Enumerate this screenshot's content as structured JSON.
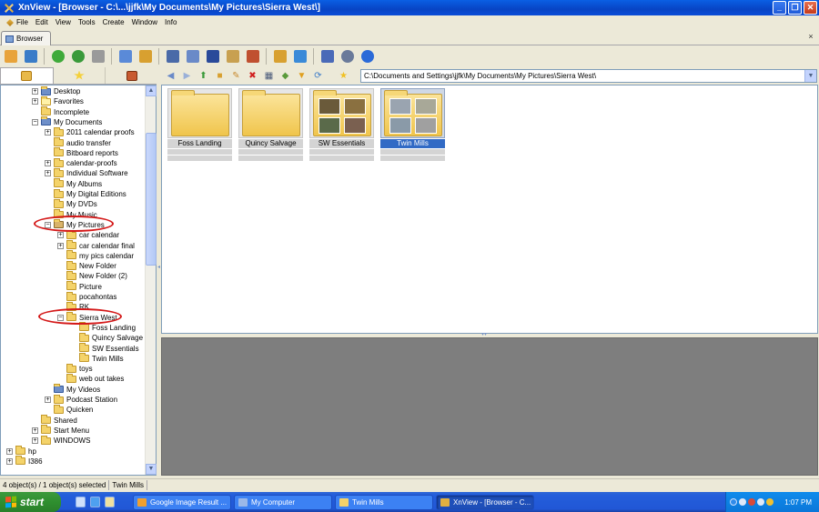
{
  "window": {
    "title": "XnView - [Browser - C:\\...\\jjfk\\My Documents\\My Pictures\\Sierra West\\]",
    "minimize": "_",
    "restore": "❐",
    "close": "✕"
  },
  "menu": [
    "File",
    "Edit",
    "View",
    "Tools",
    "Create",
    "Window",
    "Info"
  ],
  "tab": {
    "label": "Browser",
    "close": "×"
  },
  "path": "C:\\Documents and Settings\\jjfk\\My Documents\\My Pictures\\Sierra West\\",
  "tree": [
    {
      "label": "Desktop",
      "exp": "+",
      "icon": "special"
    },
    {
      "label": "Favorites",
      "exp": "+",
      "icon": "star"
    },
    {
      "label": "Incomplete",
      "exp": "",
      "icon": "folder"
    },
    {
      "label": "My Documents",
      "exp": "−",
      "icon": "special"
    },
    {
      "label": "2011 calendar proofs",
      "exp": "+",
      "icon": "folder"
    },
    {
      "label": "audio transfer",
      "exp": "",
      "icon": "folder"
    },
    {
      "label": "Bitboard reports",
      "exp": "",
      "icon": "folder"
    },
    {
      "label": "calendar-proofs",
      "exp": "+",
      "icon": "folder"
    },
    {
      "label": "Individual Software",
      "exp": "+",
      "icon": "folder"
    },
    {
      "label": "My Albums",
      "exp": "",
      "icon": "folder"
    },
    {
      "label": "My Digital Editions",
      "exp": "",
      "icon": "folder"
    },
    {
      "label": "My DVDs",
      "exp": "",
      "icon": "folder"
    },
    {
      "label": "My Music",
      "exp": "",
      "icon": "folder"
    },
    {
      "label": "My Pictures",
      "exp": "−",
      "icon": "pics"
    },
    {
      "label": "car calendar",
      "exp": "+",
      "icon": "folder"
    },
    {
      "label": "car calendar final",
      "exp": "+",
      "icon": "folder"
    },
    {
      "label": "my pics calendar",
      "exp": "",
      "icon": "folder"
    },
    {
      "label": "New Folder",
      "exp": "",
      "icon": "folder"
    },
    {
      "label": "New Folder (2)",
      "exp": "",
      "icon": "folder"
    },
    {
      "label": "Picture",
      "exp": "",
      "icon": "folder"
    },
    {
      "label": "pocahontas",
      "exp": "",
      "icon": "folder"
    },
    {
      "label": "RK",
      "exp": "",
      "icon": "folder"
    },
    {
      "label": "Sierra West",
      "exp": "−",
      "icon": "folder"
    },
    {
      "label": "Foss Landing",
      "exp": "",
      "icon": "folder"
    },
    {
      "label": "Quincy Salvage",
      "exp": "",
      "icon": "folder"
    },
    {
      "label": "SW Essentials",
      "exp": "",
      "icon": "folder"
    },
    {
      "label": "Twin Mills",
      "exp": "",
      "icon": "folder"
    },
    {
      "label": "toys",
      "exp": "",
      "icon": "folder"
    },
    {
      "label": "web out takes",
      "exp": "",
      "icon": "folder"
    },
    {
      "label": "My Videos",
      "exp": "",
      "icon": "special"
    },
    {
      "label": "Podcast Station",
      "exp": "+",
      "icon": "folder"
    },
    {
      "label": "Quicken",
      "exp": "",
      "icon": "folder"
    },
    {
      "label": "Shared",
      "exp": "",
      "icon": "folder"
    },
    {
      "label": "Start Menu",
      "exp": "+",
      "icon": "folder"
    },
    {
      "label": "WINDOWS",
      "exp": "+",
      "icon": "folder"
    },
    {
      "label": "hp",
      "exp": "+",
      "icon": "folder"
    },
    {
      "label": "I386",
      "exp": "+",
      "icon": "folder"
    }
  ],
  "thumbnails": [
    {
      "label": "Foss Landing",
      "photos": false,
      "selected": false
    },
    {
      "label": "Quincy Salvage",
      "photos": false,
      "selected": false
    },
    {
      "label": "SW Essentials",
      "photos": true,
      "selected": false
    },
    {
      "label": "Twin Mills",
      "photos": true,
      "selected": true
    }
  ],
  "status": {
    "objects": "4 object(s) / 1 object(s) selected",
    "selected_name": "Twin Mills"
  },
  "taskbar": {
    "start": "start",
    "tasks": [
      {
        "label": "Google Image Result ...",
        "color": "#f0a030",
        "active": false
      },
      {
        "label": "My Computer",
        "color": "#9bb8e8",
        "active": false
      },
      {
        "label": "Twin Mills",
        "color": "#f4d36a",
        "active": false
      },
      {
        "label": "XnView - [Browser - C...",
        "color": "#e0b040",
        "active": true
      }
    ],
    "clock": "1:07 PM"
  },
  "icons": {
    "toolbar": [
      "open-icon",
      "fullscreen-icon",
      "refresh-icon",
      "reload-icon",
      "acquire-icon",
      "favorites-icon",
      "batch-icon",
      "find-icon",
      "print-icon",
      "scanner-icon",
      "slideshow-icon",
      "wallpaper-icon",
      "webpage-icon",
      "screen-icon",
      "tools-icon",
      "settings-icon",
      "info-icon"
    ],
    "colors": [
      "#e8a33a",
      "#3a7cc8",
      "#3faa3a",
      "#3a9a3a",
      "#9a9a9a",
      "#5a8ad8",
      "#d8a030",
      "#4a6aa8",
      "#6a8ac8",
      "#2a4a9a",
      "#c8a050",
      "#c05030",
      "#d8a030",
      "#3a8ad8",
      "#4a6ab8",
      "#6a7a9a",
      "#2a6ad8"
    ]
  }
}
